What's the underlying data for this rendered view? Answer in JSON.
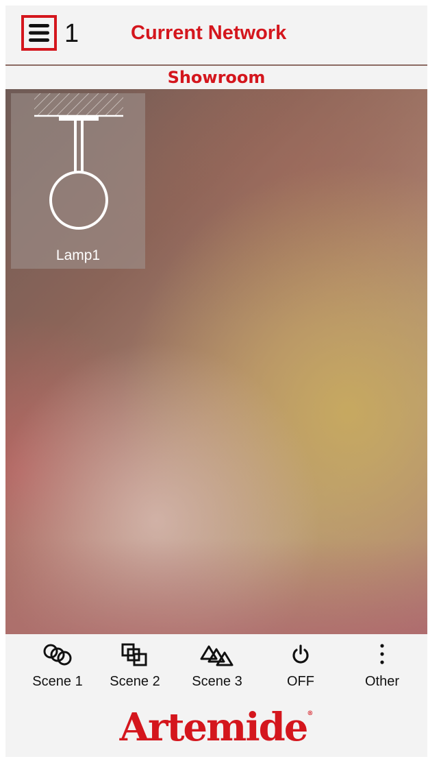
{
  "header": {
    "menu_icon": "hamburger-menu-icon",
    "count": "1",
    "title": "Current Network"
  },
  "room": {
    "name": "Showroom"
  },
  "devices": [
    {
      "name": "Lamp1",
      "icon": "pendant-lamp-icon"
    }
  ],
  "toolbar": {
    "items": [
      {
        "label": "Scene 1",
        "icon": "scene-1-icon"
      },
      {
        "label": "Scene 2",
        "icon": "scene-2-icon"
      },
      {
        "label": "Scene 3",
        "icon": "scene-3-icon"
      },
      {
        "label": "OFF",
        "icon": "power-icon"
      },
      {
        "label": "Other",
        "icon": "more-vertical-icon"
      }
    ]
  },
  "brand": {
    "logo": "Artemide",
    "mark": "®",
    "color": "#d4161d"
  }
}
